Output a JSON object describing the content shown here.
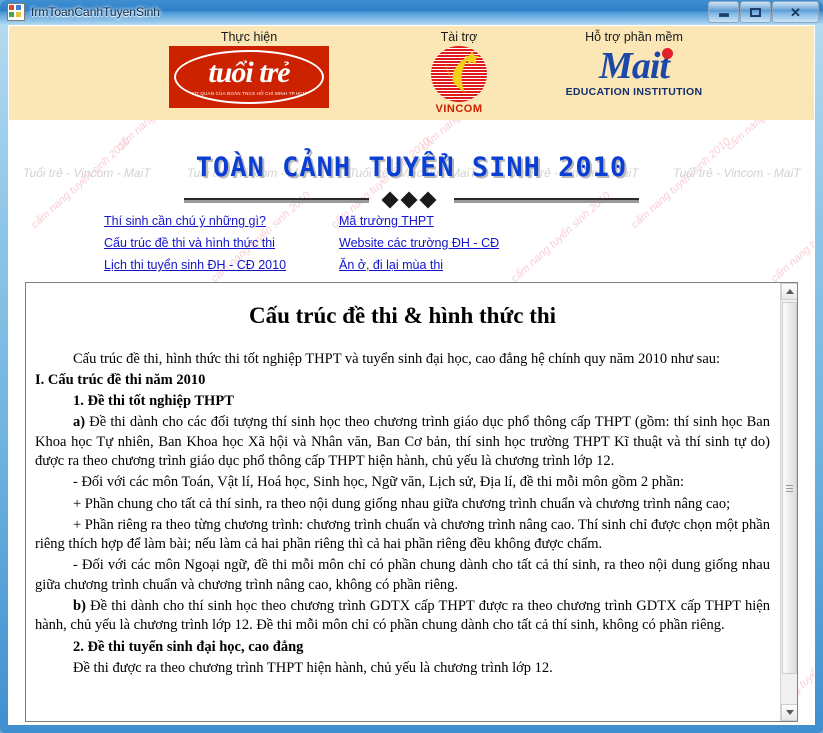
{
  "window": {
    "title": "frmToanCanhTuyenSinh",
    "icon": "form-icon",
    "buttons": {
      "minimize": "minimize-button",
      "maximize": "maximize-button",
      "close": "✕"
    }
  },
  "banner": {
    "background": "#FBE6B6",
    "sponsors": [
      {
        "caption": "Thực hiện",
        "logo_word": "tuổi trẻ",
        "logo_sub": "CƠ QUAN CỦA ĐOÀN TNCS HỒ CHÍ MINH TP.HCM",
        "color": "#CC2200"
      },
      {
        "caption": "Tài trợ",
        "logo_word": "VINCOM",
        "logo_sub": "",
        "color": "#CC2200"
      },
      {
        "caption": "Hỗ trợ phần mềm",
        "logo_word": "Mait",
        "logo_sub": "EDUCATION INSTITUTION",
        "color": "#1C49A8"
      }
    ]
  },
  "main_title": "TOÀN CẢNH TUYỂN SINH 2010",
  "main_title_color": "#0B3FD4",
  "watermarks": {
    "gray_text": "Tuổi trẻ - Vincom - MaiT",
    "pink_text": "cẩm nang tuyển sinh 2010",
    "gray_color": "#D2D2D2",
    "pink_color": "#F9C6CD"
  },
  "links": [
    {
      "label": "Thí sinh cần chú ý những gì?",
      "col": 0,
      "row": 0
    },
    {
      "label": "Cấu trúc đề thi và hình thức thi",
      "col": 0,
      "row": 1
    },
    {
      "label": "Lịch thi tuyển sinh ĐH - CĐ 2010",
      "col": 0,
      "row": 2
    },
    {
      "label": "Mã trường THPT",
      "col": 1,
      "row": 0
    },
    {
      "label": "Website các trường ĐH - CĐ",
      "col": 1,
      "row": 1
    },
    {
      "label": "Ăn ở, đi lại mùa thi",
      "col": 1,
      "row": 2
    }
  ],
  "link_color": "#1414CC",
  "document": {
    "heading": "Cấu trúc đề thi & hình thức thi",
    "paragraphs": [
      {
        "id": "p1",
        "indent": true,
        "bold": false,
        "text": "Cấu trúc đề thi, hình thức thi tốt nghiệp THPT và tuyển sinh đại học, cao đẳng hệ chính quy năm 2010 như sau:"
      },
      {
        "id": "p2",
        "indent": false,
        "bold": true,
        "text": "I. Cấu trúc đề thi năm 2010"
      },
      {
        "id": "p3",
        "indent": true,
        "bold": true,
        "text": "1. Đề thi tốt nghiệp THPT"
      },
      {
        "id": "p4",
        "indent": true,
        "bold": false,
        "lead": "a)",
        "text": " Đề thi dành cho các đối tượng thí sinh học theo chương trình giáo dục phổ thông cấp THPT (gồm: thí sinh học Ban Khoa học Tự nhiên, Ban Khoa học Xã hội và Nhân văn, Ban Cơ bản, thí sinh học trường THPT Kĩ thuật và thí sinh tự do) được ra theo chương trình giáo dục phổ thông cấp THPT hiện hành, chủ yếu là chương trình lớp 12."
      },
      {
        "id": "p5",
        "indent": true,
        "bold": false,
        "text": "- Đối với các môn Toán, Vật lí, Hoá học, Sinh học, Ngữ văn, Lịch sử, Địa lí, đề thi mỗi môn gồm 2 phần:"
      },
      {
        "id": "p6",
        "indent": true,
        "bold": false,
        "text": "+ Phần chung cho tất cả thí sinh, ra theo nội dung giống nhau giữa chương trình chuẩn và chương trình nâng cao;"
      },
      {
        "id": "p7",
        "indent": true,
        "bold": false,
        "text": "+ Phần riêng ra theo từng chương trình: chương trình chuẩn và chương trình nâng cao. Thí sinh chỉ được chọn một phần riêng thích hợp để làm bài; nếu làm cả hai phần riêng thì cả hai phần riêng đều không được chấm."
      },
      {
        "id": "p8",
        "indent": true,
        "bold": false,
        "text": "- Đối với các môn Ngoại ngữ, đề thi mỗi môn chỉ có phần chung dành cho tất cả thí sinh, ra theo nội dung giống nhau giữa chương trình chuẩn và chương trình nâng cao, không có phần riêng."
      },
      {
        "id": "p9",
        "indent": true,
        "bold": false,
        "lead": "b)",
        "text": " Đề thi dành cho thí sinh học theo chương trình GDTX cấp THPT được ra theo chương trình GDTX cấp THPT hiện hành, chủ yếu là chương trình lớp 12. Đề thi mỗi môn chỉ có phần chung dành cho tất cả thí sinh, không có phần riêng."
      },
      {
        "id": "p10",
        "indent": true,
        "bold": true,
        "text": "2. Đề thi tuyển sinh đại học, cao đẳng"
      },
      {
        "id": "p11",
        "indent": true,
        "bold": false,
        "text": "Đề thi được ra theo chương trình THPT hiện hành, chủ yếu là chương trình lớp 12."
      }
    ]
  },
  "scrollbar": {
    "up_arrow": "scroll-up-arrow",
    "down_arrow": "scroll-down-arrow",
    "thumb": "scroll-thumb"
  }
}
